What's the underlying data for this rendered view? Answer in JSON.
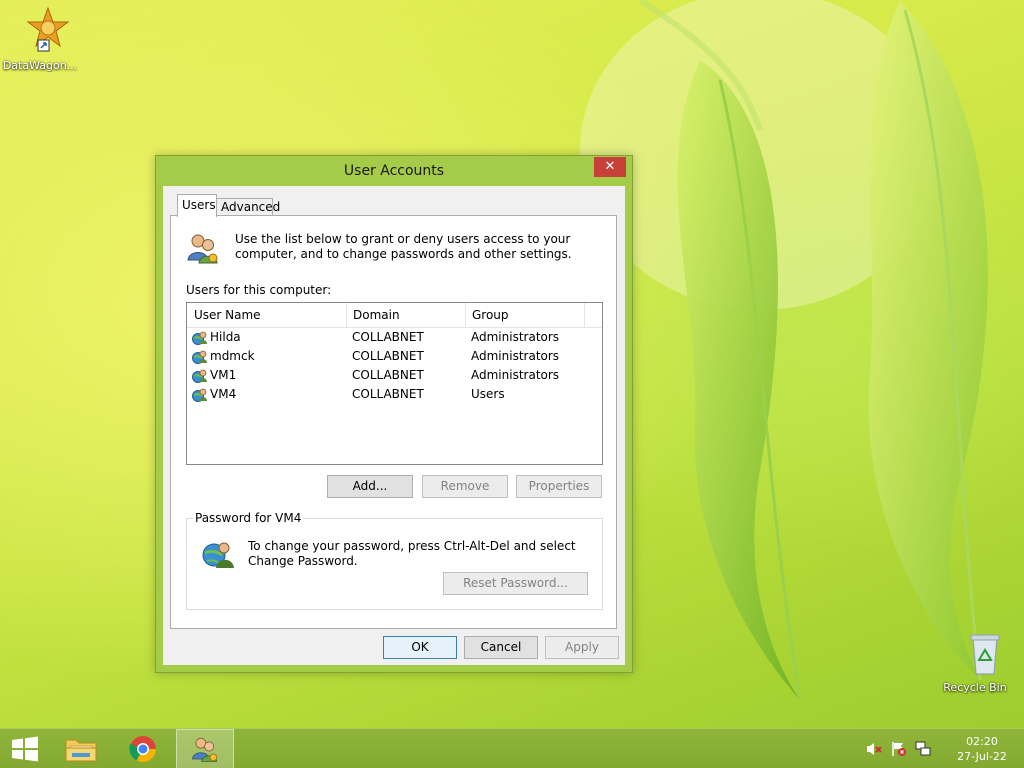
{
  "desktop": {
    "icons": [
      {
        "label": "DataWagon...",
        "icon": "datawagon-shortcut-icon"
      },
      {
        "label": "Recycle Bin",
        "icon": "recycle-bin-icon"
      }
    ]
  },
  "dialog": {
    "title": "User Accounts",
    "close_glyph": "✕",
    "tabs": [
      {
        "label": "Users",
        "active": true
      },
      {
        "label": "Advanced",
        "active": false
      }
    ],
    "info_text": "Use the list below to grant or deny users access to your computer, and to change passwords and other settings.",
    "users_label": "Users for this computer:",
    "columns": [
      "User Name",
      "Domain",
      "Group"
    ],
    "rows": [
      {
        "user": "Hilda",
        "domain": "COLLABNET",
        "group": "Administrators"
      },
      {
        "user": "mdmck",
        "domain": "COLLABNET",
        "group": "Administrators"
      },
      {
        "user": "VM1",
        "domain": "COLLABNET",
        "group": "Administrators"
      },
      {
        "user": "VM4",
        "domain": "COLLABNET",
        "group": "Users"
      }
    ],
    "buttons": {
      "add": "Add...",
      "remove": "Remove",
      "properties": "Properties"
    },
    "password_group": {
      "legend": "Password for VM4",
      "text": "To change your password, press Ctrl-Alt-Del and select Change Password.",
      "reset_button": "Reset Password..."
    },
    "footer": {
      "ok": "OK",
      "cancel": "Cancel",
      "apply": "Apply"
    }
  },
  "taskbar": {
    "items": [
      "start-button",
      "file-explorer",
      "chrome",
      "user-accounts"
    ],
    "clock": {
      "time": "02:20",
      "date": "27-Jul-22"
    }
  },
  "colors": {
    "accent_close": "#c7403a",
    "window_frame": "#a4cc48"
  }
}
